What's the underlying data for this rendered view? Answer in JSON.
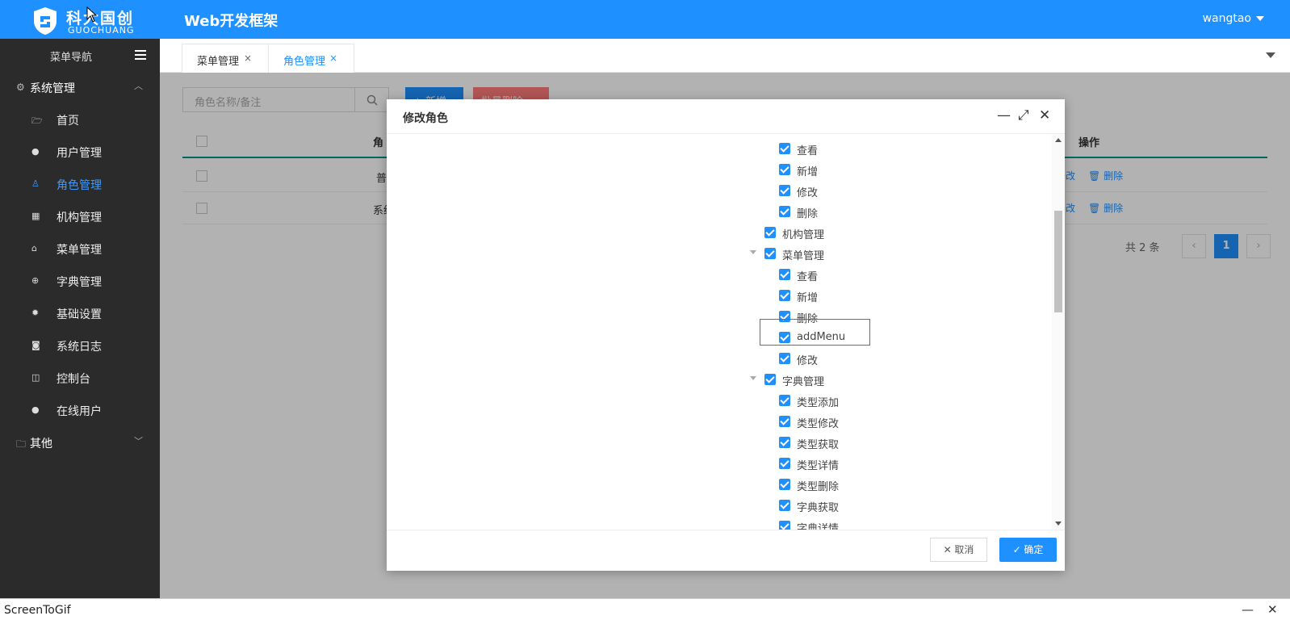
{
  "header": {
    "logo_cn": "科大国创",
    "logo_en": "GUOCHUANG",
    "app_title": "Web开发框架",
    "user_name": "wangtao"
  },
  "sidebar": {
    "title": "菜单导航",
    "group_system": "系统管理",
    "items": [
      {
        "label": "首页",
        "icon": "folder-icon"
      },
      {
        "label": "用户管理",
        "icon": "user-icon"
      },
      {
        "label": "角色管理",
        "icon": "person-icon",
        "active": true
      },
      {
        "label": "机构管理",
        "icon": "grid-icon"
      },
      {
        "label": "菜单管理",
        "icon": "bag-icon"
      },
      {
        "label": "字典管理",
        "icon": "plus-circle-icon"
      },
      {
        "label": "基础设置",
        "icon": "gear-icon"
      },
      {
        "label": "系统日志",
        "icon": "camera-icon"
      },
      {
        "label": "控制台",
        "icon": "book-icon"
      },
      {
        "label": "在线用户",
        "icon": "user-icon"
      }
    ],
    "group_other": "其他"
  },
  "tabs": [
    {
      "label": "菜单管理",
      "close": "×"
    },
    {
      "label": "角色管理",
      "close": "×",
      "active": true
    }
  ],
  "page": {
    "search_placeholder": "角色名称/备注",
    "add_label": "+ 新增",
    "delete_label": "批量删除",
    "col_role": "角",
    "col_ops": "操作",
    "rows": [
      {
        "name": "普",
        "edit": "修改",
        "delete": "删除"
      },
      {
        "name": "系统",
        "edit": "修改",
        "delete": "删除"
      }
    ],
    "pager_total": "共 2 条",
    "pager_prev": "‹",
    "pager_page": "1",
    "pager_next": "›"
  },
  "modal": {
    "title": "修改角色",
    "minimize": "—",
    "maximize": "⤢",
    "close": "✕",
    "tree": [
      {
        "label": "查看",
        "level": 2
      },
      {
        "label": "新增",
        "level": 2
      },
      {
        "label": "修改",
        "level": 2
      },
      {
        "label": "删除",
        "level": 2
      },
      {
        "label": "机构管理",
        "level": 1
      },
      {
        "label": "菜单管理",
        "level": 1,
        "expanded": true
      },
      {
        "label": "查看",
        "level": 2
      },
      {
        "label": "新增",
        "level": 2,
        "highlighted": true
      },
      {
        "label": "删除",
        "level": 2
      },
      {
        "label": "addMenu",
        "level": 2
      },
      {
        "label": "修改",
        "level": 2
      },
      {
        "label": "字典管理",
        "level": 1,
        "expanded": true
      },
      {
        "label": "类型添加",
        "level": 2
      },
      {
        "label": "类型修改",
        "level": 2
      },
      {
        "label": "类型获取",
        "level": 2
      },
      {
        "label": "类型详情",
        "level": 2
      },
      {
        "label": "类型删除",
        "level": 2
      },
      {
        "label": "字典获取",
        "level": 2
      },
      {
        "label": "字典详情",
        "level": 2
      }
    ],
    "cancel_label": "✕ 取消",
    "ok_label": "✓ 确定"
  },
  "screentogif": {
    "title": "ScreenToGif",
    "minimize": "—",
    "close": "✕"
  },
  "colors": {
    "primary": "#1e90ff",
    "sidebar_bg": "#2b2b2b",
    "highlight": "#e53935"
  }
}
